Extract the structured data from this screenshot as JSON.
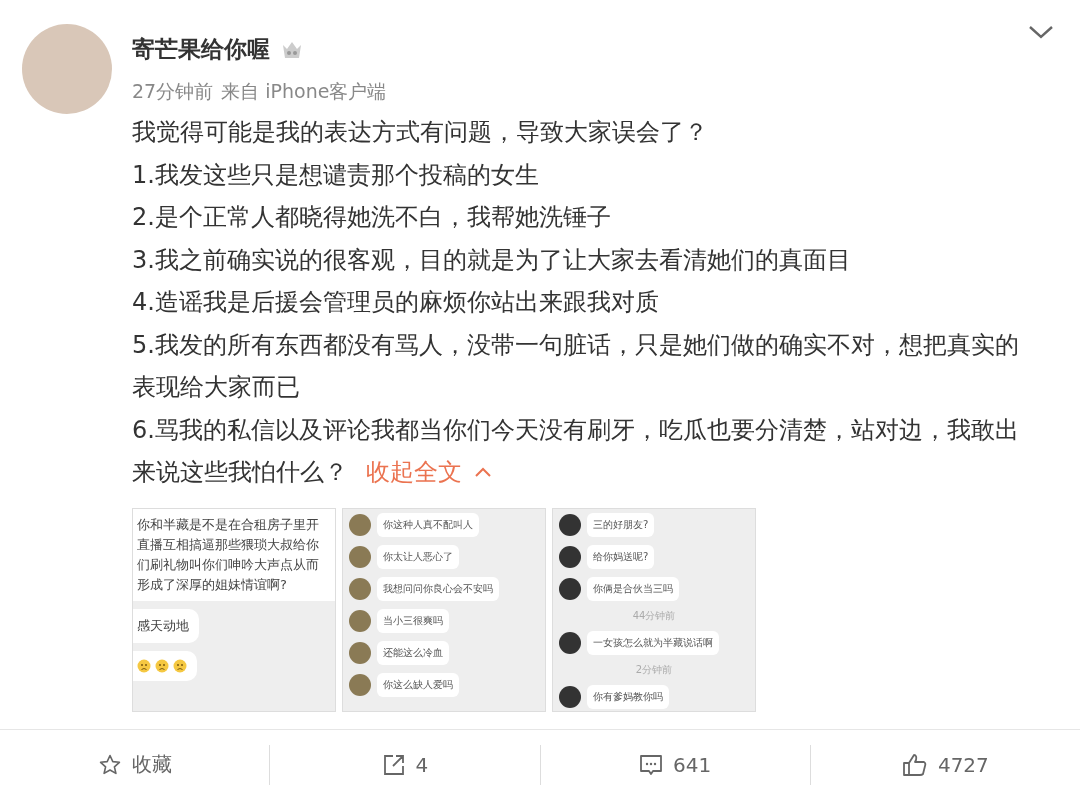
{
  "post": {
    "author": {
      "name": "寄芒果给你喔"
    },
    "time": "27分钟前",
    "source": "来自 iPhone客户端",
    "paragraphs": [
      "我觉得可能是我的表达方式有问题，导致大家误会了？",
      "1.我发这些只是想谴责那个投稿的女生",
      "2.是个正常人都晓得她洗不白，我帮她洗锤子",
      "3.我之前确实说的很客观，目的就是为了让大家去看清她们的真面目",
      "4.造谣我是后援会管理员的麻烦你站出来跟我对质",
      "5.我发的所有东西都没有骂人，没带一句脏话，只是她们做的确实不对，想把真实的表现给大家而已",
      "6.骂我的私信以及评论我都当你们今天没有刷牙，吃瓜也要分清楚，站对边，我敢出来说这些我怕什么？"
    ],
    "collapse_link": "收起全文",
    "images": [
      {
        "messages": [
          {
            "kind": "card",
            "text": "你和半藏是不是在合租房子里开直播互相搞逼那些猥琐大叔给你们刷礼物叫你们呻吟大声点从而形成了深厚的姐妹情谊啊?"
          },
          {
            "kind": "plain",
            "text": "感天动地"
          },
          {
            "kind": "emoji"
          }
        ]
      },
      {
        "messages": [
          {
            "kind": "bubble",
            "text": "你这种人真不配叫人"
          },
          {
            "kind": "bubble",
            "text": "你太让人恶心了"
          },
          {
            "kind": "bubble",
            "text": "我想问问你良心会不安吗"
          },
          {
            "kind": "bubble",
            "text": "当小三很爽吗"
          },
          {
            "kind": "bubble",
            "text": "还能这么冷血"
          },
          {
            "kind": "bubble",
            "text": "你这么缺人爱吗"
          }
        ]
      },
      {
        "messages": [
          {
            "kind": "bubble",
            "text": "三的好朋友?"
          },
          {
            "kind": "bubble",
            "text": "给你妈送呢?"
          },
          {
            "kind": "bubble",
            "text": "你俩是合伙当三吗"
          },
          {
            "kind": "time",
            "text": "44分钟前"
          },
          {
            "kind": "bubble",
            "text": "一女孩怎么就为半藏说话啊"
          },
          {
            "kind": "time",
            "text": "2分钟前"
          },
          {
            "kind": "bubble",
            "text": "你有爹妈教你吗"
          }
        ]
      }
    ]
  },
  "actions": [
    {
      "kind": "favorite",
      "label": "收藏"
    },
    {
      "kind": "repost",
      "label": "4"
    },
    {
      "kind": "comment",
      "label": "641"
    },
    {
      "kind": "like",
      "label": "4727"
    }
  ]
}
